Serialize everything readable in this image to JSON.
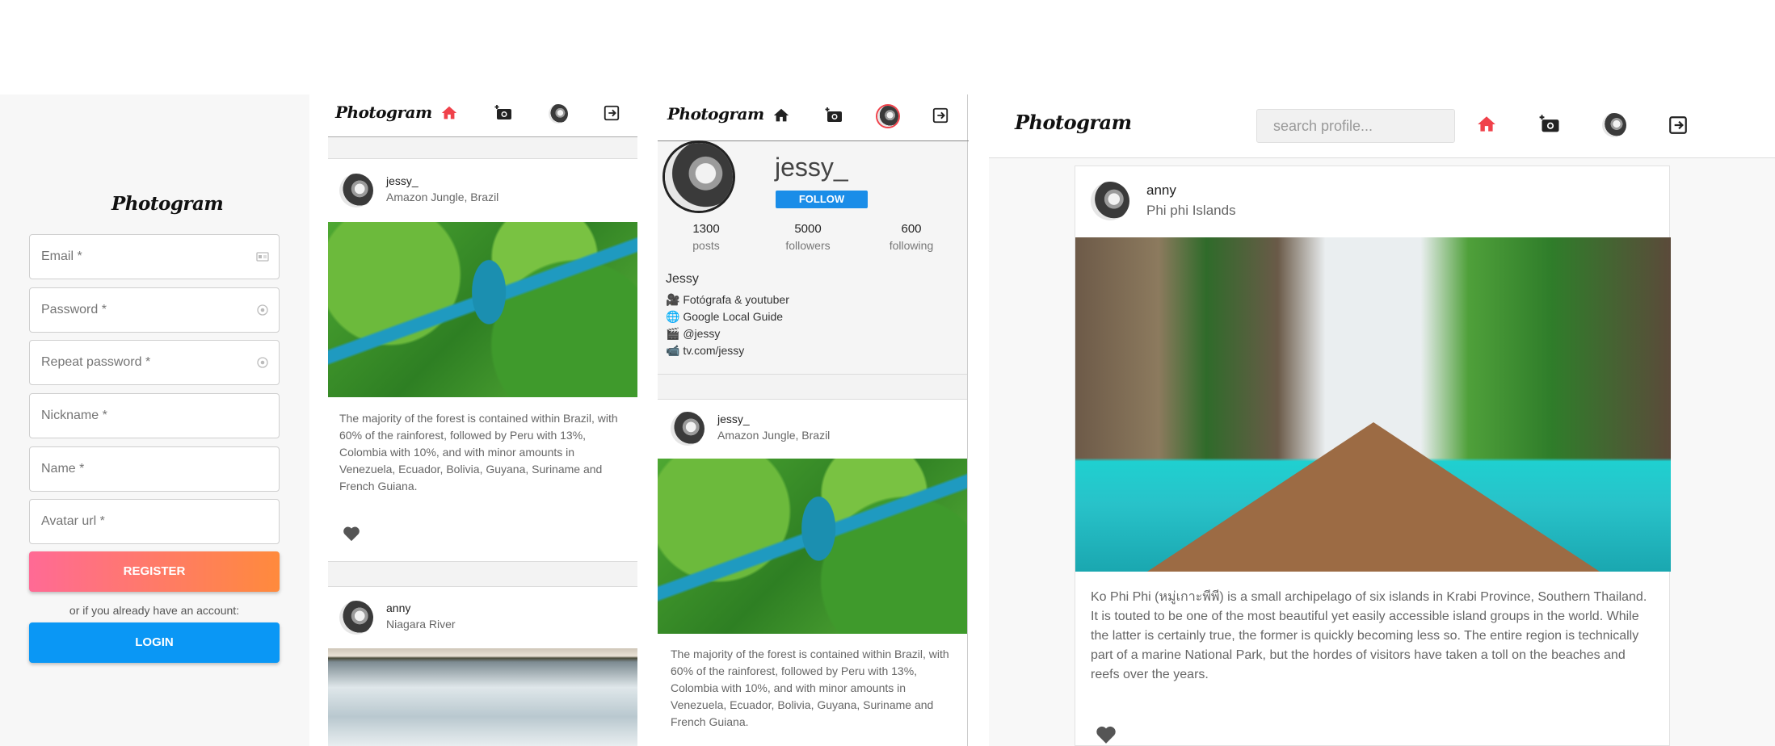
{
  "app": {
    "logo": "Photogram"
  },
  "colors": {
    "accent_red": "#f0414a",
    "register_start": "#ff6a95",
    "register_end": "#ff8a3c",
    "login_blue": "#0a97f5",
    "follow_blue": "#1a8de8"
  },
  "register": {
    "fields": [
      {
        "placeholder": "Email *",
        "icon": "id-card-icon"
      },
      {
        "placeholder": "Password *",
        "icon": "eye-icon"
      },
      {
        "placeholder": "Repeat password *",
        "icon": "eye-icon"
      },
      {
        "placeholder": "Nickname *",
        "icon": ""
      },
      {
        "placeholder": "Name *",
        "icon": ""
      },
      {
        "placeholder": "Avatar url *",
        "icon": ""
      }
    ],
    "register_label": "REGISTER",
    "alt_text": "or if you already have an account:",
    "login_label": "LOGIN"
  },
  "feed": {
    "posts": [
      {
        "user": "jessy_",
        "location": "Amazon Jungle, Brazil",
        "caption": "The majority of the forest is contained within Brazil, with 60% of the rainforest, followed by Peru with 13%, Colombia with 10%, and with minor amounts in Venezuela, Ecuador, Bolivia, Guyana, Suriname and French Guiana."
      },
      {
        "user": "anny",
        "location": "Niagara River",
        "caption": ""
      }
    ]
  },
  "profile": {
    "username": "jessy_",
    "follow_label": "FOLLOW",
    "stats": [
      {
        "value": "1300",
        "label": "posts"
      },
      {
        "value": "5000",
        "label": "followers"
      },
      {
        "value": "600",
        "label": "following"
      }
    ],
    "display_name": "Jessy",
    "bio": [
      {
        "icon": "🎥",
        "text": "Fotógrafa & youtuber"
      },
      {
        "icon": "🌐",
        "text": "Google Local Guide"
      },
      {
        "icon": "🎬",
        "text": "@jessy"
      },
      {
        "icon": "📹",
        "text": "tv.com/jessy"
      }
    ],
    "post": {
      "user": "jessy_",
      "location": "Amazon Jungle, Brazil",
      "caption": "The majority of the forest is contained within Brazil, with 60% of the rainforest, followed by Peru with 13%, Colombia with 10%, and with minor amounts in Venezuela, Ecuador, Bolivia, Guyana, Suriname and French Guiana."
    }
  },
  "desktop": {
    "search_placeholder": "search profile...",
    "post": {
      "user": "anny",
      "location": "Phi phi Islands",
      "caption": "Ko Phi Phi (หมู่เกาะพีพี) is a small archipelago of six islands in Krabi Province, Southern Thailand. It is touted to be one of the most beautiful yet easily accessible island groups in the world. While the latter is certainly true, the former is quickly becoming less so. The entire region is technically part of a marine National Park, but the hordes of visitors have taken a toll on the beaches and reefs over the years."
    }
  }
}
